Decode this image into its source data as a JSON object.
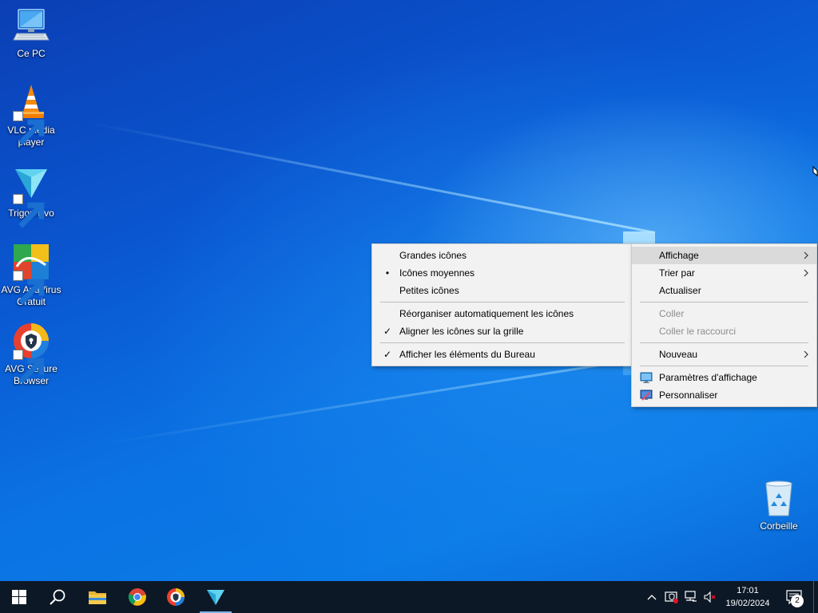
{
  "desktop": {
    "icons": [
      {
        "name": "this-pc",
        "label": "Ce PC"
      },
      {
        "name": "vlc",
        "label": "VLC media player"
      },
      {
        "name": "trigon",
        "label": "Trigon Evo"
      },
      {
        "name": "avg-antivirus",
        "label": "AVG AntiVirus Gratuit"
      },
      {
        "name": "avg-browser",
        "label": "AVG Secure Browser"
      },
      {
        "name": "recycle-bin",
        "label": "Corbeille"
      }
    ]
  },
  "context_menu": {
    "items": [
      {
        "label": "Affichage",
        "has_submenu": true,
        "state": "hover"
      },
      {
        "label": "Trier par",
        "has_submenu": true
      },
      {
        "label": "Actualiser"
      },
      {
        "label": "Coller",
        "disabled": true
      },
      {
        "label": "Coller le raccourci",
        "disabled": true
      },
      {
        "label": "Nouveau",
        "has_submenu": true
      },
      {
        "label": "Paramètres d'affichage",
        "icon": "display-settings-icon"
      },
      {
        "label": "Personnaliser",
        "icon": "personalize-icon"
      }
    ]
  },
  "view_submenu": {
    "items": [
      {
        "label": "Grandes icônes"
      },
      {
        "label": "Icônes moyennes",
        "mark": "•"
      },
      {
        "label": "Petites icônes"
      },
      {
        "label": "Réorganiser automatiquement les icônes"
      },
      {
        "label": "Aligner les icônes sur la grille",
        "mark": "✓"
      },
      {
        "label": "Afficher les éléments du Bureau",
        "mark": "✓"
      }
    ]
  },
  "taskbar": {
    "pinned": [
      "start-button",
      "search-button",
      "file-explorer",
      "chrome",
      "avg-secure-browser",
      "trigon-evo"
    ],
    "active_app": "trigon-evo",
    "tray_icons": [
      "chevron-up-icon",
      "security-icon",
      "network-icon",
      "volume-muted-icon"
    ],
    "clock": {
      "time": "17:01",
      "date": "19/02/2024"
    },
    "notification_count": "2"
  },
  "colors": {
    "taskbar_bg": "#0c1826",
    "menu_bg": "#f2f2f2",
    "menu_hover": "#dadada",
    "accent": "#0078d7"
  }
}
